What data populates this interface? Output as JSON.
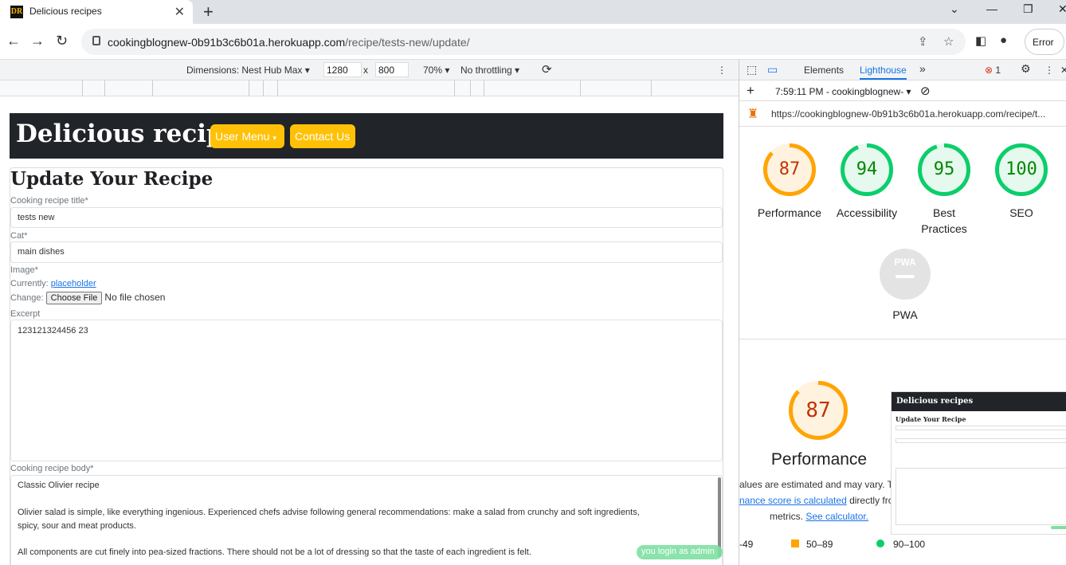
{
  "browser": {
    "tab_title": "Delicious recipes",
    "favicon_text": "DR",
    "url_domain": "cookingblognew-0b91b3c6b01a.herokuapp.com",
    "url_path": "/recipe/tests-new/update/",
    "error_label": "Error"
  },
  "devtools_bar": {
    "dimensions_label": "Dimensions: Nest Hub Max",
    "width": "1280",
    "times": "x",
    "height": "800",
    "zoom": "70%",
    "throttling": "No throttling"
  },
  "site": {
    "brand": "Delicious recipes",
    "user_menu": "User Menu",
    "contact": "Contact Us"
  },
  "form": {
    "heading": "Update Your Recipe",
    "title_label": "Cooking recipe title*",
    "title_value": "tests new",
    "cat_label": "Cat*",
    "cat_value": "main dishes",
    "image_label": "Image*",
    "currently_label": "Currently:",
    "currently_link": "placeholder",
    "change_label": "Change:",
    "choose_file": "Choose File",
    "no_file": "No file chosen",
    "excerpt_label": "Excerpt",
    "excerpt_value": "123121324456 23",
    "body_label": "Cooking recipe body*",
    "body_line1": "Classic Olivier recipe",
    "body_line2": "Olivier salad is simple, like everything ingenious. Experienced chefs advise following general recommendations: make a salad from crunchy and soft ingredients,",
    "body_line3": "spicy, sour and meat products.",
    "body_line4": "All components are cut finely into pea-sized fractions. There should not be a lot of dressing so that the taste of each ingredient is felt.",
    "toast": "you login as admin"
  },
  "lighthouse": {
    "tabs": [
      "Elements",
      "Lighthouse"
    ],
    "error_count": "1",
    "timestamp": "7:59:11 PM - cookingblognew-",
    "report_url": "https://cookingblognew-0b91b3c6b01a.herokuapp.com/recipe/t...",
    "scores": [
      {
        "label": "Performance",
        "value": "87",
        "color": "#ffa400"
      },
      {
        "label": "Accessibility",
        "value": "94",
        "color": "#0cce6b"
      },
      {
        "label": "Best Practices",
        "value": "95",
        "color": "#0cce6b"
      },
      {
        "label": "SEO",
        "value": "100",
        "color": "#0cce6b"
      }
    ],
    "pwa_label": "PWA",
    "pwa_badge": "PWA",
    "big_score": "87",
    "big_label": "Performance",
    "note1": "alues are estimated and may vary. T",
    "note2_link": "nance score is calculated",
    "note2_rest": " directly fro",
    "note3": "metrics.",
    "note3_link": "See calculator.",
    "legend": [
      "-49",
      "50–89",
      "90–100"
    ],
    "thumb_brand": "Delicious recipes",
    "thumb_heading": "Update Your Recipe"
  }
}
